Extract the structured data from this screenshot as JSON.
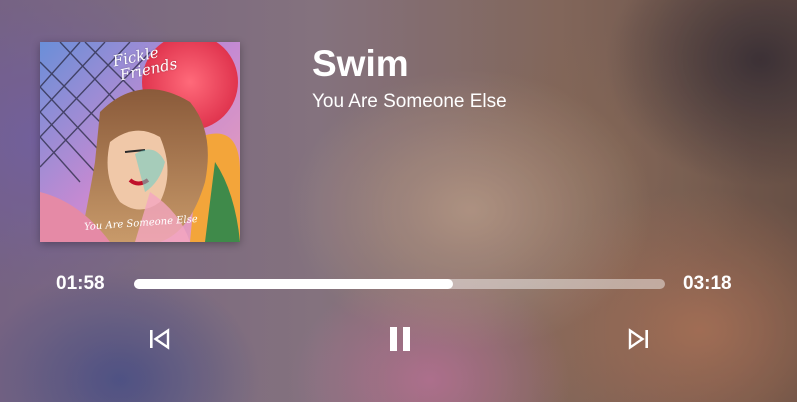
{
  "track": {
    "title": "Swim",
    "artist_album": "You Are Someone Else"
  },
  "cover": {
    "band_line1": "Fickle",
    "band_line2": "Friends",
    "album_script": "You Are Someone Else"
  },
  "playback": {
    "elapsed": "01:58",
    "total": "03:18",
    "progress_fraction": 0.6
  },
  "controls": {
    "previous_icon": "skip-previous-icon",
    "pause_icon": "pause-icon",
    "next_icon": "skip-next-icon"
  },
  "colors": {
    "text": "#ffffff",
    "progress_fill": "#ffffff",
    "progress_track": "rgba(255,255,255,0.45)"
  }
}
